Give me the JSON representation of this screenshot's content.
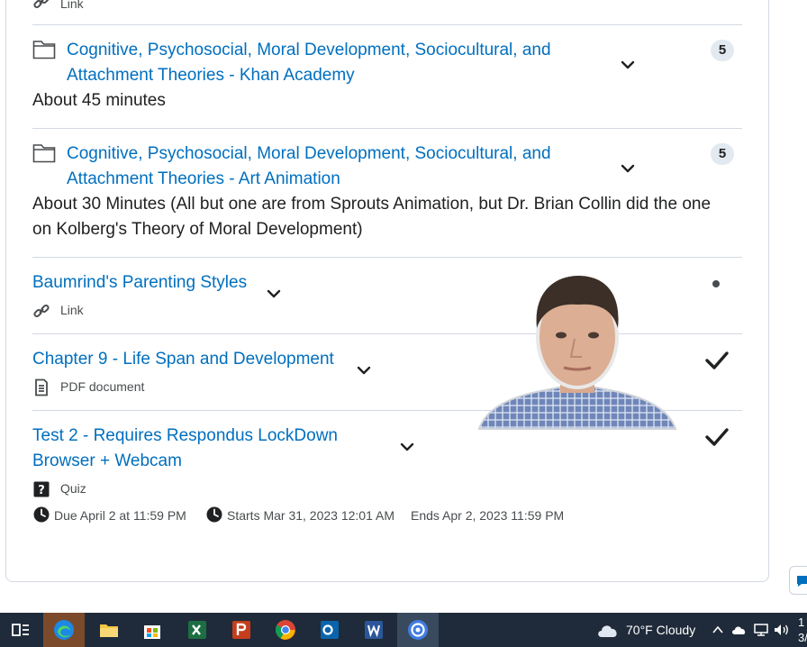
{
  "items": {
    "top_link_meta": "Link",
    "khan": {
      "title_line1": "Cognitive, Psychosocial, Moral Development, Sociocultural, and",
      "title_line2": "Attachment Theories - Khan Academy",
      "count": "5",
      "description": "About 45 minutes"
    },
    "art": {
      "title_line1": "Cognitive, Psychosocial, Moral Development, Sociocultural, and",
      "title_line2": "Attachment Theories - Art Animation",
      "count": "5",
      "description_line1": "About 30 Minutes (All but one are from Sprouts Animation, but Dr. Brian Collin did the one",
      "description_line2": "on Kolberg's Theory of Moral Development)"
    },
    "baumrind": {
      "title": "Baumrind's Parenting Styles",
      "meta": "Link"
    },
    "chapter9": {
      "title": "Chapter 9 - Life Span and Development",
      "meta": "PDF document"
    },
    "test2": {
      "title_line1": "Test 2 - Requires Respondus LockDown",
      "title_line2": "Browser + Webcam",
      "meta": "Quiz",
      "due": "Due April 2 at 11:59 PM",
      "starts": "Starts Mar 31, 2023 12:01 AM",
      "ends": "Ends Apr 2, 2023 11:59 PM"
    }
  },
  "taskbar": {
    "weather": "70°F  Cloudy",
    "clock_line1": "1",
    "clock_line2": "3/"
  },
  "colors": {
    "link": "#006fbf",
    "taskbar": "#1f2b3a",
    "divider": "#d3d9e3"
  }
}
